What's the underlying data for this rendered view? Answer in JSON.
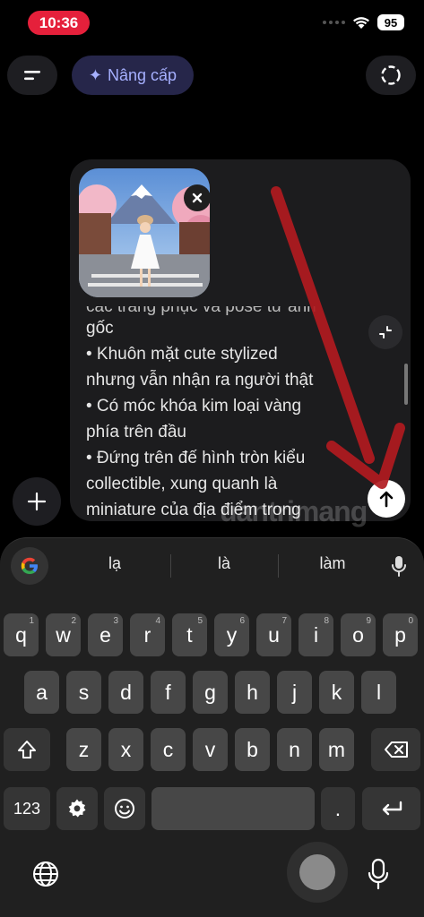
{
  "status_bar": {
    "time": "10:36",
    "battery": "95"
  },
  "header": {
    "upgrade_label": "Nâng cấp",
    "upgrade_star": "✦"
  },
  "composer": {
    "cut_line": "các trang phục và pose từ ảnh",
    "lines": [
      "gốc",
      "• Khuôn mặt cute stylized",
      "nhưng vẫn nhận ra người thật",
      "• Có móc khóa kim loại vàng",
      "phía trên đầu",
      "• Đứng trên đế hình tròn kiểu",
      "collectible, xung quanh là",
      "miniature của địa điểm trong"
    ]
  },
  "watermark": "uantrimang",
  "keyboard": {
    "suggestions": [
      "lạ",
      "là",
      "làm"
    ],
    "row1": [
      {
        "k": "q",
        "n": "1"
      },
      {
        "k": "w",
        "n": "2"
      },
      {
        "k": "e",
        "n": "3"
      },
      {
        "k": "r",
        "n": "4"
      },
      {
        "k": "t",
        "n": "5"
      },
      {
        "k": "y",
        "n": "6"
      },
      {
        "k": "u",
        "n": "7"
      },
      {
        "k": "i",
        "n": "8"
      },
      {
        "k": "o",
        "n": "9"
      },
      {
        "k": "p",
        "n": "0"
      }
    ],
    "row2": [
      "a",
      "s",
      "d",
      "f",
      "g",
      "h",
      "j",
      "k",
      "l"
    ],
    "row3": [
      "z",
      "x",
      "c",
      "v",
      "b",
      "n",
      "m"
    ],
    "numbers_label": "123",
    "period": "."
  },
  "colors": {
    "time_pill": "#e5203b",
    "upgrade_text": "#a6b0ff",
    "upgrade_bg": "#26264a"
  }
}
